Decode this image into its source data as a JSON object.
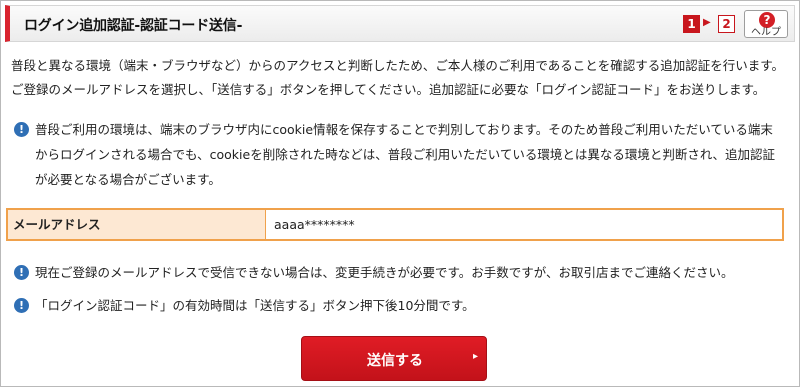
{
  "header": {
    "title": "ログイン追加認証-認証コード送信-",
    "steps": [
      "1",
      "2"
    ],
    "help_label": "ヘルプ",
    "help_icon": "?"
  },
  "intro": {
    "line1": "普段と異なる環境（端末・ブラウザなど）からのアクセスと判断したため、ご本人様のご利用であることを確認する追加認証を行います。",
    "line2": "ご登録のメールアドレスを選択し、「送信する」ボタンを押してください。追加認証に必要な「ログイン認証コード」をお送りします。"
  },
  "cookie_notice": {
    "text": "普段ご利用の環境は、端末のブラウザ内にcookie情報を保存することで判別しております。そのため普段ご利用いただいている端末からログインされる場合でも、cookieを削除された時などは、普段ご利用いただいている環境とは異なる環境と判断され、追加認証が必要となる場合がございます。"
  },
  "email": {
    "label": "メールアドレス",
    "value": "aaaa********"
  },
  "notes": [
    "現在ご登録のメールアドレスで受信できない場合は、変更手続きが必要です。お手数ですが、お取引店までご連絡ください。",
    "「ログイン認証コード」の有効時間は「送信する」ボタン押下後10分間です。"
  ],
  "submit": {
    "label": "送信する",
    "arrow": "▸"
  },
  "colors": {
    "accent_red": "#d9232e",
    "info_blue": "#2f6fb5",
    "highlight_orange": "#f0a14b"
  }
}
